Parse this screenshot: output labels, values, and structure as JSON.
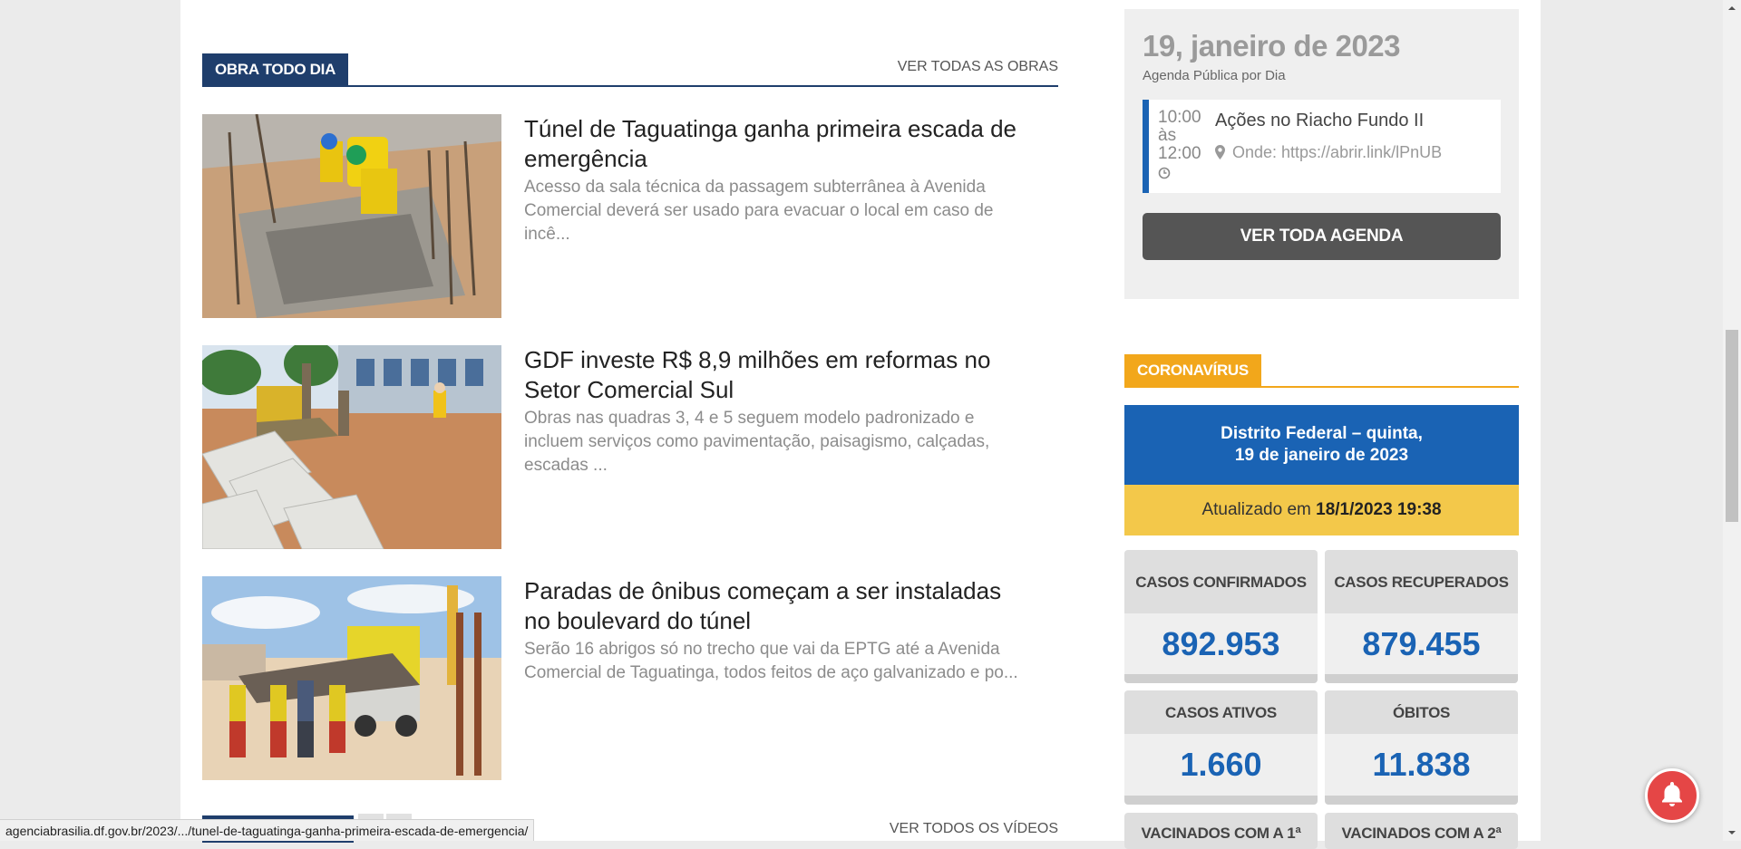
{
  "obra_section": {
    "tag": "OBRA TODO DIA",
    "more_link": "VER TODAS AS OBRAS",
    "articles": [
      {
        "title": "Túnel de Taguatinga ganha primeira escada de emergência",
        "excerpt": "Acesso da sala técnica da passagem subterrânea à Avenida Comercial deverá ser usado para evacuar o local em caso de incê..."
      },
      {
        "title": "GDF investe R$ 8,9 milhões em reformas no Setor Comercial Sul",
        "excerpt": "Obras nas quadras 3, 4 e 5 seguem modelo padronizado e incluem serviços como pavimentação, paisagismo, calçadas, escadas ..."
      },
      {
        "title": "Paradas de ônibus começam a ser instaladas no boulevard do túnel",
        "excerpt": "Serão 16 abrigos só no trecho que vai da EPTG até a Avenida Comercial de Taguatinga, todos feitos de aço galvanizado e po..."
      }
    ]
  },
  "video_section": {
    "more_link": "VER TODOS OS VÍDEOS"
  },
  "agenda": {
    "date": "19, janeiro de 2023",
    "subtitle": "Agenda Pública por Dia",
    "event": {
      "time_start": "10:00",
      "time_sep": "às",
      "time_end": "12:00",
      "title": "Ações no Riacho Fundo II",
      "location": "Onde: https://abrir.link/lPnUB"
    },
    "button": "VER TODA AGENDA"
  },
  "corona": {
    "tag": "CORONAVÍRUS",
    "region_line1": "Distrito Federal – quinta,",
    "region_line2": "19 de janeiro de 2023",
    "updated_prefix": "Atualizado em",
    "updated_value": "18/1/2023 19:38",
    "stats": [
      {
        "label": "CASOS CONFIRMADOS",
        "value": "892.953"
      },
      {
        "label": "CASOS RECUPERADOS",
        "value": "879.455"
      },
      {
        "label": "CASOS ATIVOS",
        "value": "1.660"
      },
      {
        "label": "ÓBITOS",
        "value": "11.838"
      },
      {
        "label": "VACINADOS COM A 1ª",
        "value": ""
      },
      {
        "label": "VACINADOS COM A 2ª",
        "value": ""
      }
    ]
  },
  "status_url": "agenciabrasilia.df.gov.br/2023/.../tunel-de-taguatinga-ganha-primeira-escada-de-emergencia/",
  "colors": {
    "navy": "#1f3e6c",
    "blue": "#1a63b4",
    "orange": "#f2a71b",
    "yellow": "#f3c84a",
    "notify_red": "#e54646"
  },
  "icons": [
    "map-marker-icon",
    "clock-icon",
    "bell-icon"
  ]
}
